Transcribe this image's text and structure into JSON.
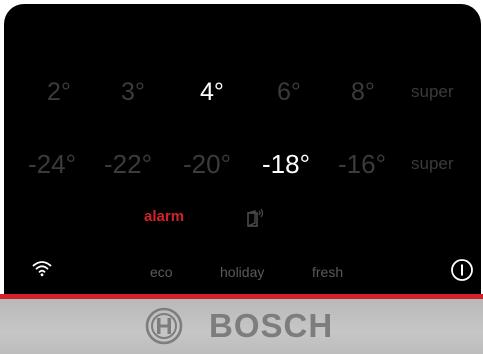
{
  "fridge": {
    "temps": [
      "2°",
      "3°",
      "4°",
      "6°",
      "8°"
    ],
    "selected": "4°",
    "super_label": "super"
  },
  "freezer": {
    "temps": [
      "-24°",
      "-22°",
      "-20°",
      "-18°",
      "-16°"
    ],
    "selected": "-18°",
    "super_label": "super"
  },
  "status": {
    "alarm_label": "alarm",
    "door_icon": "door-open-icon",
    "wifi_icon": "wifi-icon"
  },
  "modes": [
    "eco",
    "holiday",
    "fresh"
  ],
  "power_icon": "power-icon",
  "brand": {
    "name": "BOSCH",
    "logo": "bosch-logo"
  },
  "colors": {
    "display": "#000000",
    "inactive": "#3b3b3b",
    "active": "#ffffff",
    "alarm": "#d1232a",
    "mode_text": "#5a5a5a",
    "brand_bar": "#c2c2c2",
    "brand_text": "#7d7d7d"
  }
}
